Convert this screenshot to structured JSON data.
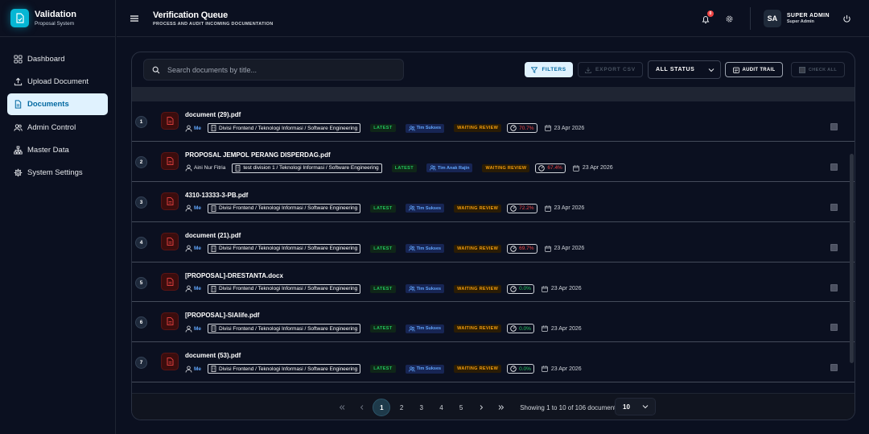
{
  "brand": {
    "title": "Validation",
    "subtitle": "Proposal System"
  },
  "sidebar": {
    "items": [
      {
        "label": "Dashboard",
        "icon": "grid-icon",
        "active": false
      },
      {
        "label": "Upload Document",
        "icon": "upload-icon",
        "active": false
      },
      {
        "label": "Documents",
        "icon": "file-icon",
        "active": true
      },
      {
        "label": "Admin Control",
        "icon": "users-icon",
        "active": false
      },
      {
        "label": "Master Data",
        "icon": "sitemap-icon",
        "active": false
      },
      {
        "label": "System Settings",
        "icon": "gear-icon",
        "active": false
      }
    ]
  },
  "header": {
    "title": "Verification Queue",
    "subtitle": "PROCESS AND AUDIT INCOMING DOCUMENTATION",
    "notification_count": "0",
    "user_initials": "SA",
    "user_name": "SUPER ADMIN",
    "user_role": "Super Admin"
  },
  "toolbar": {
    "search_placeholder": "Search documents by title...",
    "filters_label": "FILTERS",
    "export_label": "EXPORT CSV",
    "status_label": "ALL STATUS",
    "audit_label": "AUDIT TRAIL",
    "check_all_label": "CHECK ALL"
  },
  "documents": [
    {
      "num": "1",
      "name": "document (29).pdf",
      "owner": "Me",
      "division": "Divisi Frontend / Teknologi Informasi / Software Engineering",
      "version": "LATEST",
      "team": "Tim Sukses",
      "status": "WAITING REVIEW",
      "score": "70.7%",
      "date": "23 Apr 2026"
    },
    {
      "num": "2",
      "name": "PROPOSAL JEMPOL PERANG DISPERDAG.pdf",
      "owner": "Aini Nur Fitria",
      "division": "test division 1 / Teknologi Informasi / Software Engineering",
      "version": "LATEST",
      "team": "Tim Anak Rajin",
      "status": "WAITING REVIEW",
      "score": "67.4%",
      "date": "23 Apr 2026"
    },
    {
      "num": "3",
      "name": "4310-13333-3-PB.pdf",
      "owner": "Me",
      "division": "Divisi Frontend / Teknologi Informasi / Software Engineering",
      "version": "LATEST",
      "team": "Tim Sukses",
      "status": "WAITING REVIEW",
      "score": "72.2%",
      "date": "23 Apr 2026"
    },
    {
      "num": "4",
      "name": "document (21).pdf",
      "owner": "Me",
      "division": "Divisi Frontend / Teknologi Informasi / Software Engineering",
      "version": "LATEST",
      "team": "Tim Sukses",
      "status": "WAITING REVIEW",
      "score": "69.7%",
      "date": "23 Apr 2026"
    },
    {
      "num": "5",
      "name": "[PROPOSAL]-DRESTANTA.docx",
      "owner": "Me",
      "division": "Divisi Frontend / Teknologi Informasi / Software Engineering",
      "version": "LATEST",
      "team": "Tim Sukses",
      "status": "WAITING REVIEW",
      "score": "0.0%",
      "date": "23 Apr 2026"
    },
    {
      "num": "6",
      "name": "[PROPOSAL]-SIAlife.pdf",
      "owner": "Me",
      "division": "Divisi Frontend / Teknologi Informasi / Software Engineering",
      "version": "LATEST",
      "team": "Tim Sukses",
      "status": "WAITING REVIEW",
      "score": "0.0%",
      "date": "23 Apr 2026"
    },
    {
      "num": "7",
      "name": "document (53).pdf",
      "owner": "Me",
      "division": "Divisi Frontend / Teknologi Informasi / Software Engineering",
      "version": "LATEST",
      "team": "Tim Sukses",
      "status": "WAITING REVIEW",
      "score": "0.0%",
      "date": "23 Apr 2026"
    }
  ],
  "pagination": {
    "pages": [
      "1",
      "2",
      "3",
      "4",
      "5"
    ],
    "current": "1",
    "showing": "Showing 1 to 10 of 106 documents",
    "per_page": "10"
  },
  "colors": {
    "accent": "#06b6d4",
    "danger": "#ef4444",
    "success": "#22c55e",
    "warning": "#f59e0b",
    "link": "#60a5fa"
  }
}
